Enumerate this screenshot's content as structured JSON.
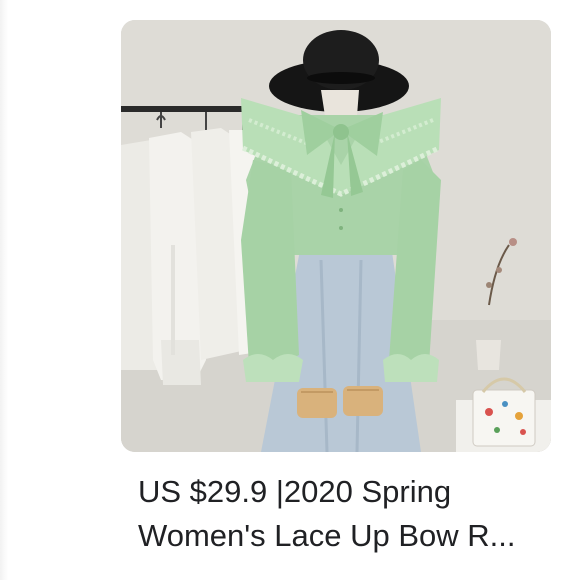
{
  "product": {
    "title_line1": "US $29.9 |2020 Spring",
    "title_line2": "Women's Lace Up Bow R...",
    "image_icon": "product-photo"
  },
  "colors": {
    "background": "#ffffff",
    "title_text": "#202124",
    "blouse": "#a9d3a8",
    "wall": "#dddcd7"
  }
}
